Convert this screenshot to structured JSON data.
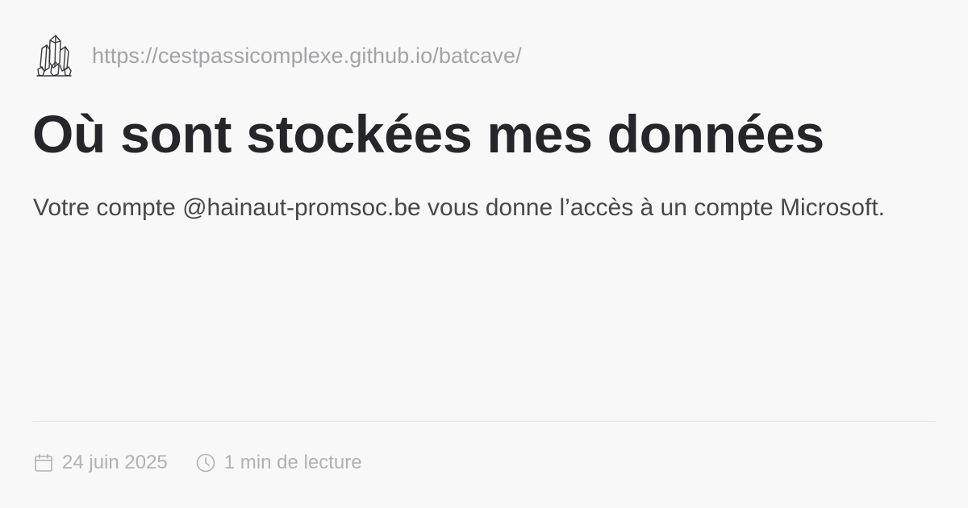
{
  "site": {
    "logo_icon": "crystal-cluster-icon",
    "url": "https://cestpassicomplexe.github.io/batcave/"
  },
  "article": {
    "title": "Où sont stockées mes données",
    "description": "Votre compte @hainaut-promsoc.be vous donne l’accès à un compte Microsoft."
  },
  "meta": {
    "date_icon": "calendar-icon",
    "date": "24 juin 2025",
    "reading_time_icon": "clock-icon",
    "reading_time": "1 min de lecture"
  },
  "colors": {
    "background": "#f9f8f9",
    "title": "#26252a",
    "body_text": "#48474b",
    "muted": "#a3a3a6",
    "divider": "#e2e1e3"
  }
}
